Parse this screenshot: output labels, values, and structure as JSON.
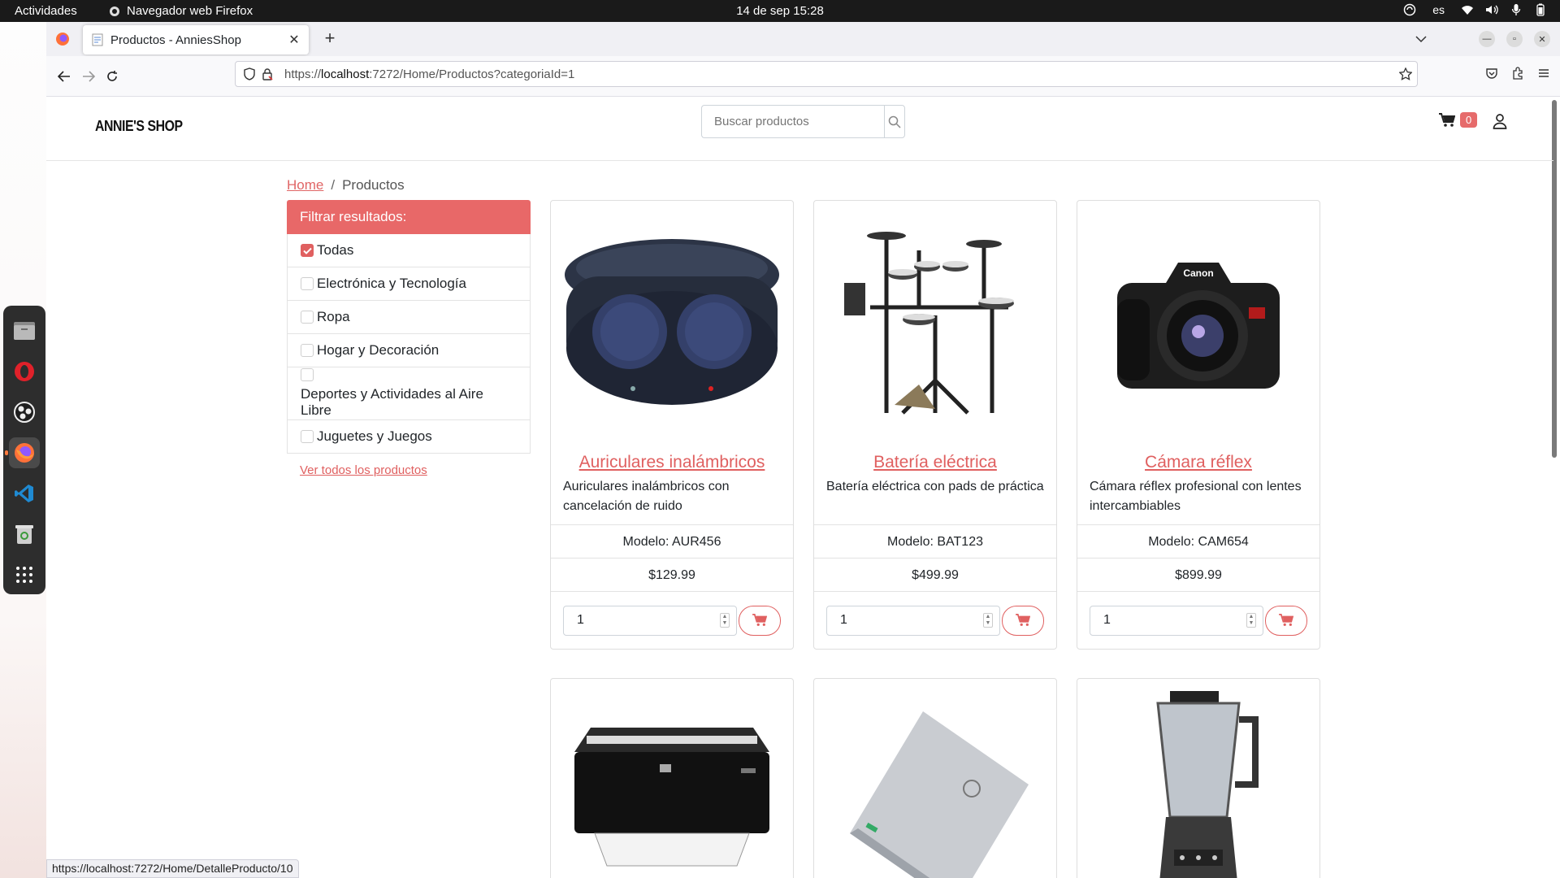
{
  "system": {
    "activities": "Actividades",
    "app_name": "Navegador web Firefox",
    "clock": "14 de sep  15:28",
    "lang": "es"
  },
  "browser": {
    "tab_title": "Productos - AnniesShop",
    "url_prefix": "https://",
    "url_host": "localhost",
    "url_rest": ":7272/Home/Productos?categoriaId=1",
    "status_url": "https://localhost:7272/Home/DetalleProducto/10"
  },
  "shop": {
    "brand": "ANNIE'S SHOP",
    "search_placeholder": "Buscar productos",
    "cart_count": "0"
  },
  "breadcrumb": {
    "home": "Home",
    "separator": "/",
    "current": "Productos"
  },
  "filter": {
    "header": "Filtrar resultados:",
    "items": [
      {
        "label": "Todas",
        "checked": true
      },
      {
        "label": "Electrónica y Tecnología",
        "checked": false
      },
      {
        "label": "Ropa",
        "checked": false
      },
      {
        "label": "Hogar y Decoración",
        "checked": false
      },
      {
        "label": "Deportes y Actividades al Aire Libre",
        "checked": false
      },
      {
        "label": "Juguetes y Juegos",
        "checked": false
      }
    ],
    "view_all": "Ver todos los productos"
  },
  "products": [
    {
      "title": "Auriculares inalámbricos",
      "description": "Auriculares inalámbricos con cancelación de ruido",
      "model": "Modelo: AUR456",
      "price": "$129.99",
      "qty": "1",
      "image": "earbuds-image"
    },
    {
      "title": "Batería eléctrica",
      "description": "Batería eléctrica con pads de práctica",
      "model": "Modelo: BAT123",
      "price": "$499.99",
      "qty": "1",
      "image": "drum-kit-image"
    },
    {
      "title": "Cámara réflex",
      "description": "Cámara réflex profesional con lentes intercambiables",
      "model": "Modelo: CAM654",
      "price": "$899.99",
      "qty": "1",
      "image": "camera-image"
    },
    {
      "image": "printer-image"
    },
    {
      "image": "laptop-image"
    },
    {
      "image": "blender-image"
    }
  ],
  "colors": {
    "accent": "#e86868",
    "link": "#e06060",
    "topbar": "#1a1a1a"
  }
}
